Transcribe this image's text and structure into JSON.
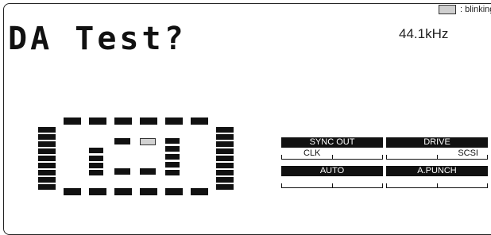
{
  "legend": {
    "swatch_color": "#d2d2d2",
    "text": ": blinking"
  },
  "display": {
    "title": "DA Test?",
    "sample_rate": "44.1kHz"
  },
  "status": {
    "sync_out": {
      "label": "SYNC OUT",
      "value_left": "CLK",
      "value_right": ""
    },
    "drive": {
      "label": "DRIVE",
      "value_left": "",
      "value_right": "SCSI"
    },
    "auto": {
      "label": "AUTO",
      "value_left": "",
      "value_right": ""
    },
    "a_punch": {
      "label": "A.PUNCH",
      "value_left": "",
      "value_right": ""
    }
  }
}
